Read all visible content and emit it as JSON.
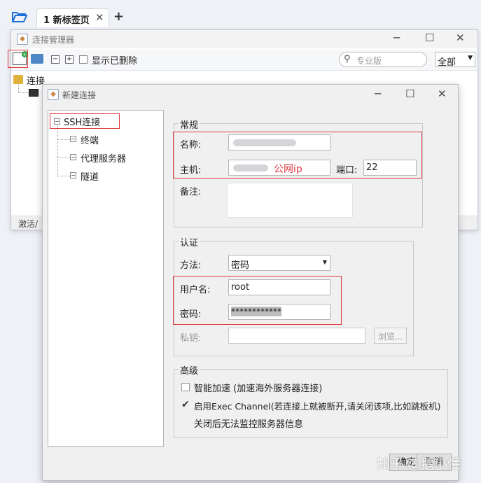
{
  "tabbar": {
    "tab_label": "1 新标签页",
    "close_glyph": "✕",
    "add_glyph": "+"
  },
  "manager": {
    "title": "连接管理器",
    "show_deleted": "显示已删除",
    "search_placeholder": "专业版",
    "scope_value": "全部",
    "tree_root": "连接",
    "status_text": "激活/"
  },
  "dialog": {
    "title": "新建连接",
    "nav": {
      "items": [
        "SSH连接",
        "终端",
        "代理服务器",
        "隧道"
      ]
    },
    "general": {
      "legend": "常规",
      "name_label": "名称:",
      "host_label": "主机:",
      "host_annotation": "公网ip",
      "port_label": "端口:",
      "port_value": "22",
      "note_label": "备注:"
    },
    "auth": {
      "legend": "认证",
      "method_label": "方法:",
      "method_value": "密码",
      "username_label": "用户名:",
      "username_value": "root",
      "password_label": "密码:",
      "password_value": "************",
      "key_label": "私钥:",
      "browse_label": "浏览..."
    },
    "advanced": {
      "legend": "高级",
      "smart_accel": "智能加速 (加速海外服务器连接)",
      "smart_accel_checked": false,
      "exec_channel": "启用Exec Channel(若连接上就被断开,请关闭该项,比如跳板机)",
      "exec_channel_checked": true,
      "exec_channel_note": "关闭后无法监控服务器信息"
    },
    "ok_label": "确定",
    "cancel_label": "取消"
  },
  "watermark": "知乎 @鹅小懂",
  "colors": {
    "annotation_red": "#e0393e",
    "accent_blue": "#1e6fd9"
  }
}
